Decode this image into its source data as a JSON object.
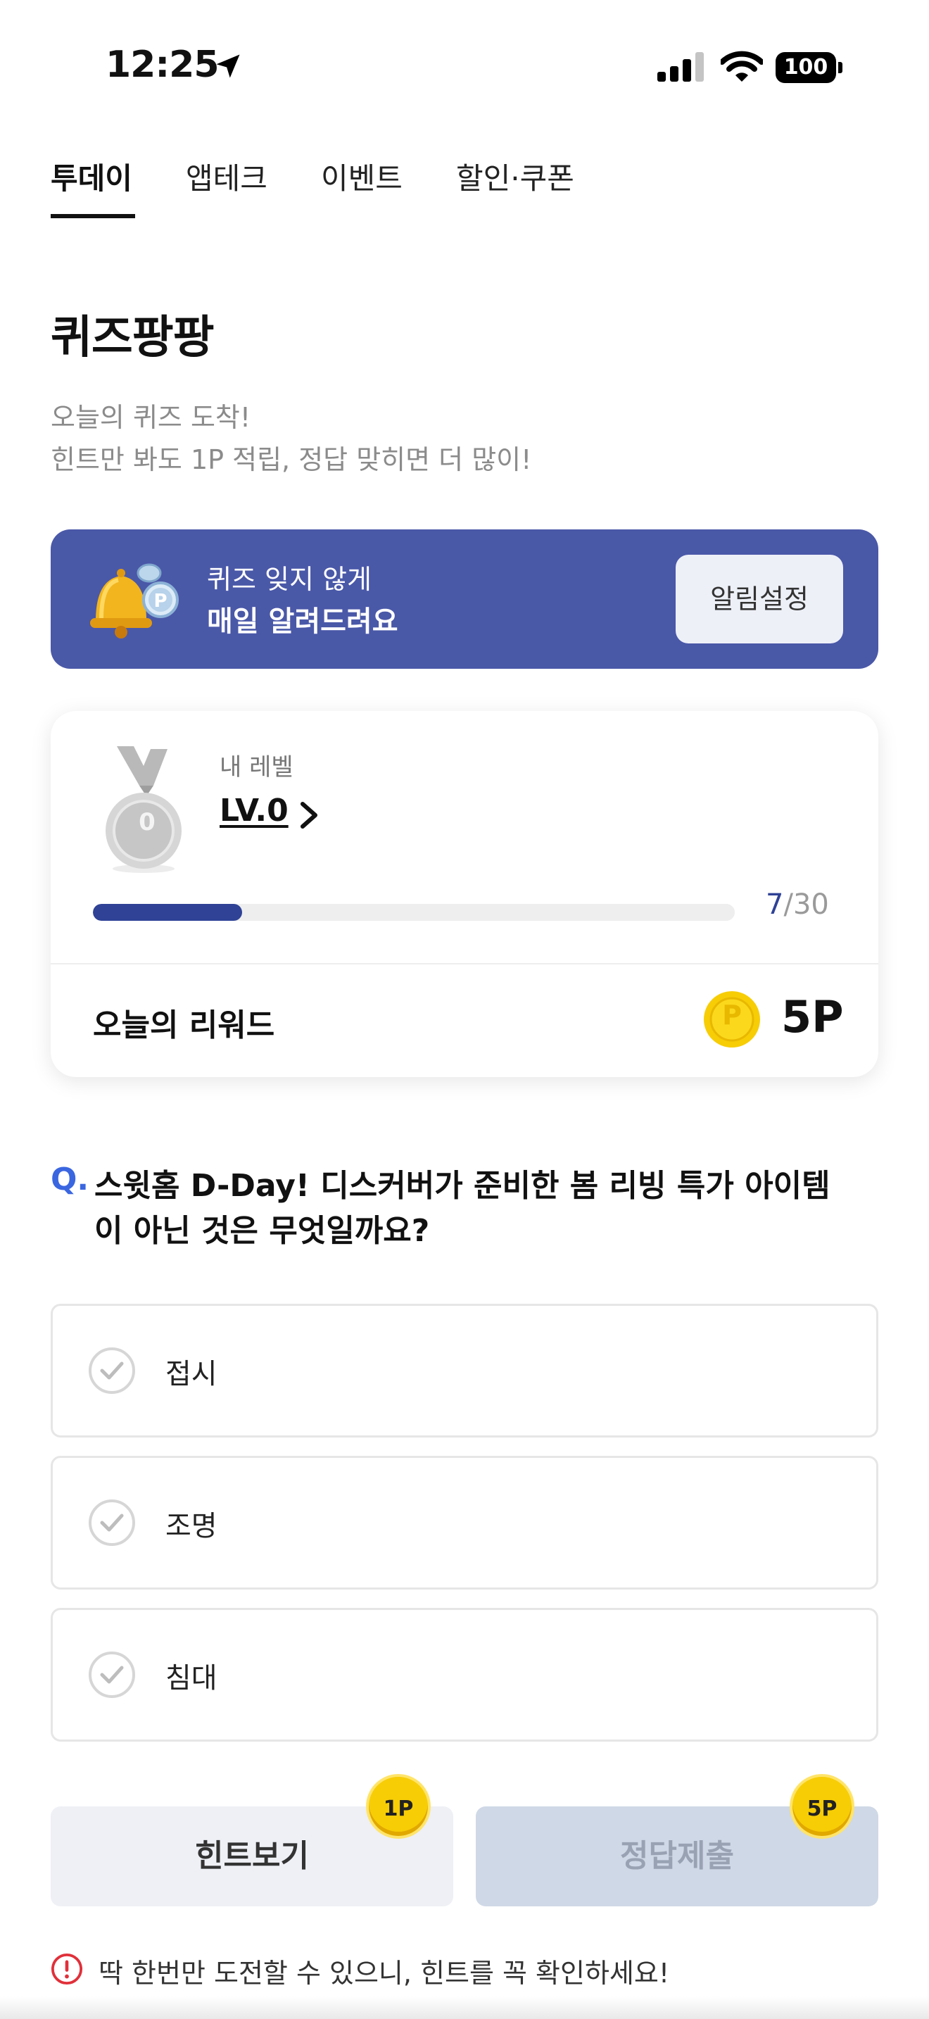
{
  "status_bar": {
    "time": "12:25",
    "battery": "100"
  },
  "tabs": [
    {
      "label": "투데이",
      "active": true
    },
    {
      "label": "앱테크",
      "active": false
    },
    {
      "label": "이벤트",
      "active": false
    },
    {
      "label": "할인·쿠폰",
      "active": false
    }
  ],
  "page": {
    "title": "퀴즈팡팡",
    "subtitle_line1": "오늘의 퀴즈 도착!",
    "subtitle_line2": "힌트만 봐도 1P 적립, 정답 맞히면 더 많이!"
  },
  "banner": {
    "line1": "퀴즈 잊지 않게",
    "line2": "매일 알려드려요",
    "button": "알림설정",
    "color": "#4a58a8",
    "icon": "bell-coin-icon"
  },
  "level_card": {
    "label": "내 레벨",
    "level": "LV.0",
    "medal_number": "0",
    "progress_current": "7",
    "progress_separator": "/",
    "progress_max": "30",
    "progress_fraction": 0.233,
    "reward_label": "오늘의 리워드",
    "coin_letter": "P",
    "reward_value": "5P"
  },
  "question": {
    "mark": "Q.",
    "line1": "스윗홈 D-Day! 디스커버가 준비한 봄 리빙 특가 아이템",
    "line2": "이 아닌 것은 무엇일까요?"
  },
  "options": [
    {
      "label": "접시"
    },
    {
      "label": "조명"
    },
    {
      "label": "침대"
    }
  ],
  "buttons": {
    "hint": "힌트보기",
    "hint_badge": "1P",
    "submit": "정답제출",
    "submit_badge": "5P"
  },
  "notice": "딱 한번만 도전할 수 있으니, 힌트를 꼭 확인하세요!",
  "colors": {
    "accent": "#2f4296",
    "question_mark": "#3a66e0",
    "coin": "#f7cd06",
    "warning": "#e0303a"
  }
}
